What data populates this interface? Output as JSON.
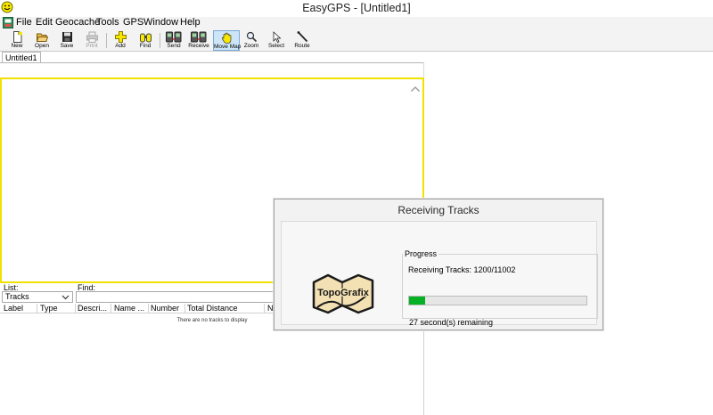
{
  "window": {
    "title": "EasyGPS - [Untitled1]"
  },
  "menu": [
    "File",
    "Edit",
    "Geocache",
    "Tools",
    "GPS",
    "Window",
    "Help"
  ],
  "toolbar": {
    "new": "New",
    "open": "Open",
    "save": "Save",
    "print": "Print",
    "add": "Add",
    "find": "Find",
    "send": "Send",
    "receive": "Receive",
    "move_map": "Move Map",
    "zoom": "Zoom",
    "select": "Select",
    "route": "Route"
  },
  "document_tab": "Untitled1",
  "list_panel": {
    "list_label": "List:",
    "find_label": "Find:",
    "selected_list": "Tracks",
    "columns": [
      "Label",
      "Type",
      "Descri...",
      "Name ...",
      "Number",
      "Total Distance",
      "Ne"
    ],
    "empty_message": "There are no tracks to display"
  },
  "dialog": {
    "title": "Receiving Tracks",
    "logo_text": "TopoGrafix",
    "group_title": "Progress",
    "progress_text": "Receiving Tracks: 1200/11002",
    "progress_fraction": 0.0909,
    "remaining_text": "27 second(s) remaining",
    "progress_color": "#06b025"
  }
}
